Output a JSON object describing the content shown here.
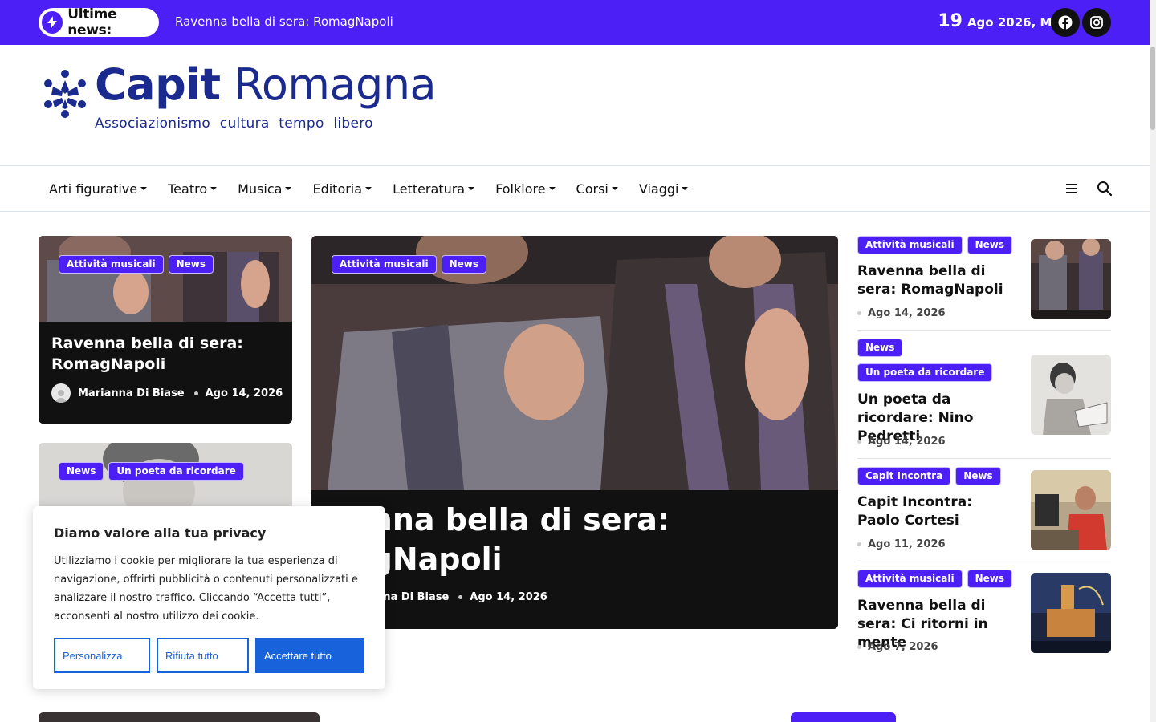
{
  "topbar": {
    "breaking_label": "Ultime news:",
    "ticker_text": "Ravenna bella di sera: RomagNapoli",
    "date_day": "19",
    "date_rest": "Ago 2026, Mer",
    "icons": [
      "bolt-icon",
      "facebook-icon",
      "instagram-icon"
    ],
    "accent_color": "#4b1ff5"
  },
  "logo": {
    "name_bold": "Capit",
    "name_rest": "Romagna",
    "tagline": "Associazionismo cultura tempo libero",
    "color": "#1b2a8f"
  },
  "nav": {
    "items": [
      {
        "label": "Arti figurative"
      },
      {
        "label": "Teatro"
      },
      {
        "label": "Musica"
      },
      {
        "label": "Editoria"
      },
      {
        "label": "Letteratura"
      },
      {
        "label": "Folklore"
      },
      {
        "label": "Corsi"
      },
      {
        "label": "Viaggi"
      }
    ]
  },
  "left_cards": [
    {
      "tags": [
        "Attività musicali",
        "News"
      ],
      "title": "Ravenna bella di sera: RomagNapoli",
      "author": "Marianna Di Biase",
      "date": "Ago 14, 2026"
    },
    {
      "tags": [
        "News",
        "Un poeta da ricordare"
      ]
    }
  ],
  "featured": {
    "tags": [
      "Attività musicali",
      "News"
    ],
    "title": "enna bella di sera: agNapoli",
    "author": "nna Di Biase",
    "date": "Ago 14, 2026"
  },
  "sidebar": {
    "items": [
      {
        "tags": [
          "Attività musicali",
          "News"
        ],
        "title": "Ravenna bella di sera: RomagNapoli",
        "date": "Ago 14, 2026"
      },
      {
        "tags": [
          "News",
          "Un poeta da ricordare"
        ],
        "title": "Un poeta da ricordare: Nino Pedretti",
        "date": "Ago 14, 2026"
      },
      {
        "tags": [
          "Capit Incontra",
          "News"
        ],
        "title": "Capit Incontra: Paolo Cortesi",
        "date": "Ago 11, 2026"
      },
      {
        "tags": [
          "Attività musicali",
          "News"
        ],
        "title": "Ravenna bella di sera: Ci ritorni in mente",
        "date": "Ago 7, 2026"
      }
    ]
  },
  "cookie": {
    "title": "Diamo valore alla tua privacy",
    "text": "Utilizziamo i cookie per migliorare la tua esperienza di navigazione, offrirti pubblicità o contenuti personalizzati e analizzare il nostro traffico. Cliccando “Accetta tutti”, acconsenti al nostro utilizzo dei cookie.",
    "customize_label": "Personalizza",
    "reject_label": "Rifiuta tutto",
    "accept_label": "Accettare tutto",
    "button_color": "#1863dc"
  }
}
